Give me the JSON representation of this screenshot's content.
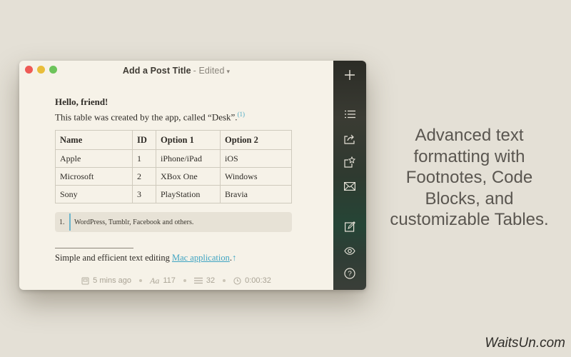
{
  "window": {
    "title": "Add a Post Title",
    "status_suffix": "- Edited",
    "caret": "▾"
  },
  "document": {
    "greeting": "Hello, friend!",
    "intro": "This table was created by the app, called “Desk”.",
    "intro_footnote_ref": "(1)",
    "table": {
      "headers": [
        "Name",
        "ID",
        "Option 1",
        "Option 2"
      ],
      "rows": [
        [
          "Apple",
          "1",
          "iPhone/iPad",
          "iOS"
        ],
        [
          "Microsoft",
          "2",
          "XBox One",
          "Windows"
        ],
        [
          "Sony",
          "3",
          "PlayStation",
          "Bravia"
        ]
      ]
    },
    "footnote": {
      "number": "1.",
      "text": "WordPress, Tumblr, Facebook and others."
    },
    "closing_text": "Simple and efficient text editing ",
    "closing_link": "Mac application",
    "closing_end": ".",
    "closing_arrow": "↑"
  },
  "statusbar": {
    "time_ago": "5 mins ago",
    "font_icon_label": "Aa",
    "char_count": "117",
    "line_count": "32",
    "timer": "0:00:32"
  },
  "sidebar": {
    "icons": [
      "plus-icon",
      "list-icon",
      "share-icon",
      "publish-icon",
      "mail-icon",
      "edit-icon",
      "eye-icon",
      "help-icon"
    ]
  },
  "marketing": {
    "text": "Advanced text formatting with Footnotes, Code Blocks, and customizable Tables."
  },
  "watermark": "WaitsUn.com",
  "colors": {
    "accent_link": "#3fa4c2",
    "footnote_bar": "#6db6cc",
    "close": "#ee5a55",
    "minimize": "#e9bd3a",
    "zoom": "#6dc45a"
  }
}
